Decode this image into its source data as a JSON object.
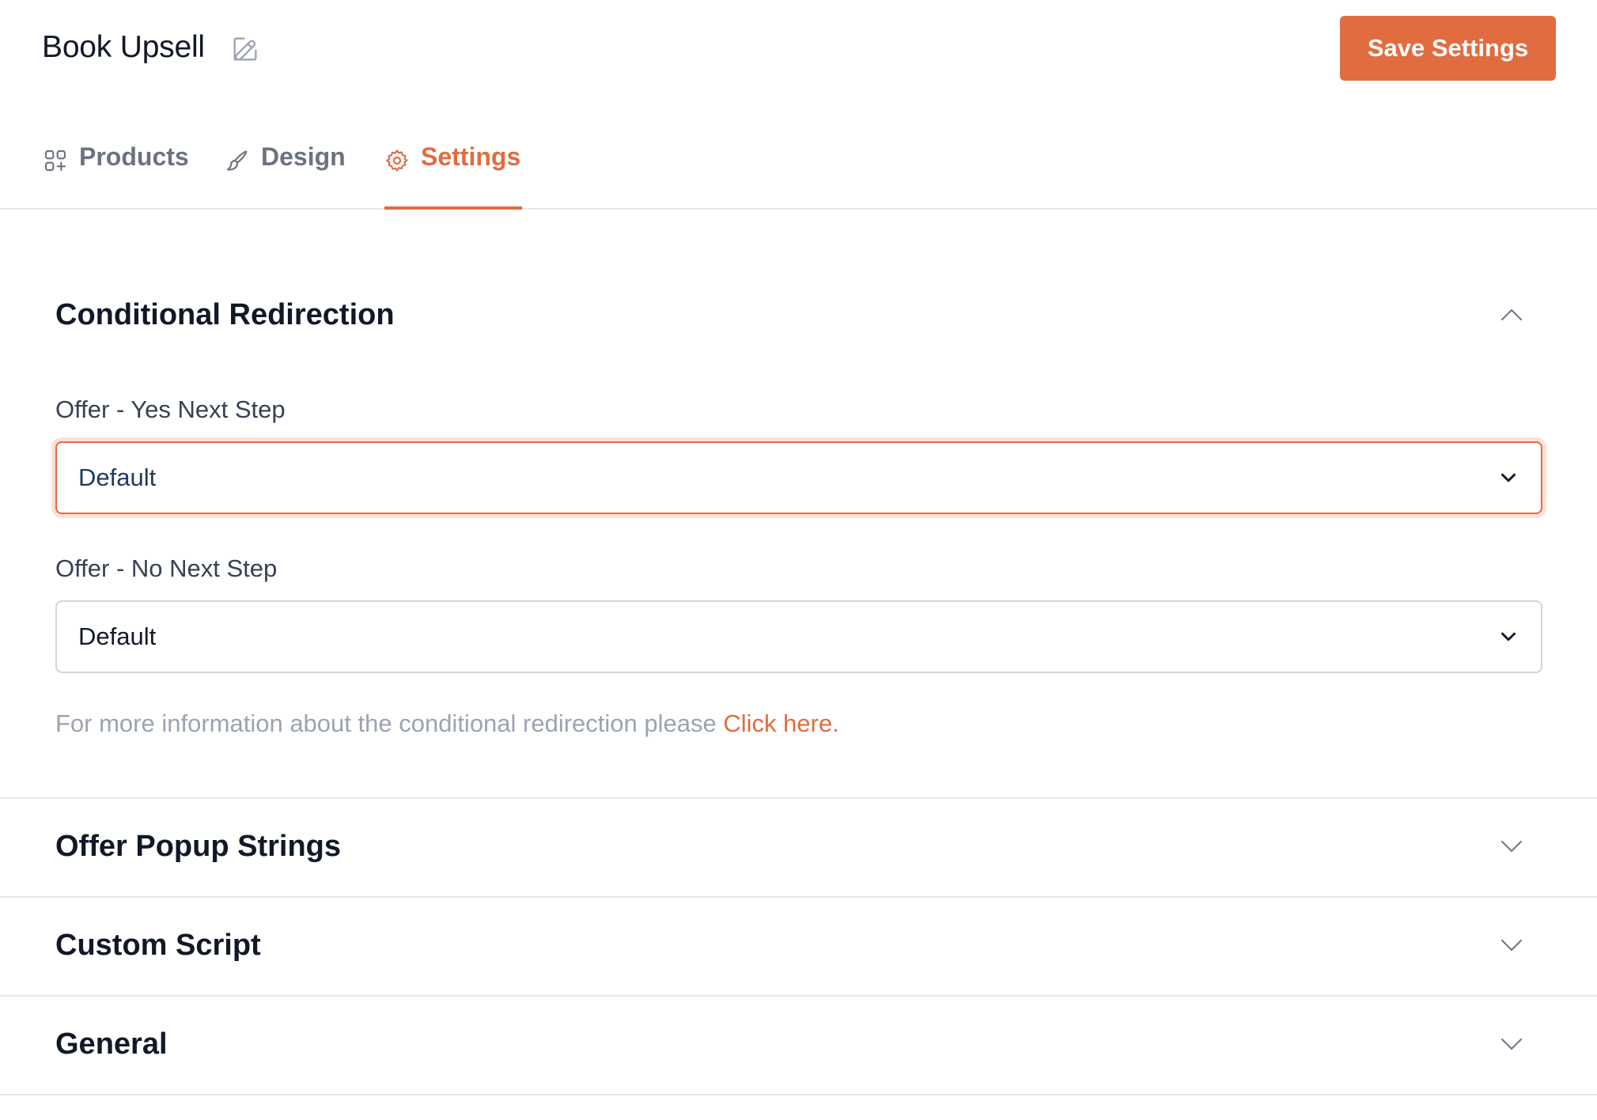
{
  "header": {
    "title": "Book Upsell",
    "edit_icon": "pencil-icon",
    "save_label": "Save Settings"
  },
  "tabs": [
    {
      "label": "Products",
      "icon": "grid-plus-icon",
      "active": false
    },
    {
      "label": "Design",
      "icon": "brush-icon",
      "active": false
    },
    {
      "label": "Settings",
      "icon": "gear-icon",
      "active": true
    }
  ],
  "sections": {
    "conditional": {
      "title": "Conditional Redirection",
      "expanded": true,
      "yes_label": "Offer - Yes Next Step",
      "yes_value": "Default",
      "no_label": "Offer - No Next Step",
      "no_value": "Default",
      "info_text": "For more information about the conditional redirection please ",
      "info_link": "Click here."
    },
    "popup": {
      "title": "Offer Popup Strings",
      "expanded": false
    },
    "script": {
      "title": "Custom Script",
      "expanded": false
    },
    "general": {
      "title": "General",
      "expanded": false
    }
  },
  "colors": {
    "accent": "#e06c40",
    "focus_ring": "#fbe1d6",
    "border": "#e5e7eb",
    "muted_text": "#9ca3af"
  }
}
